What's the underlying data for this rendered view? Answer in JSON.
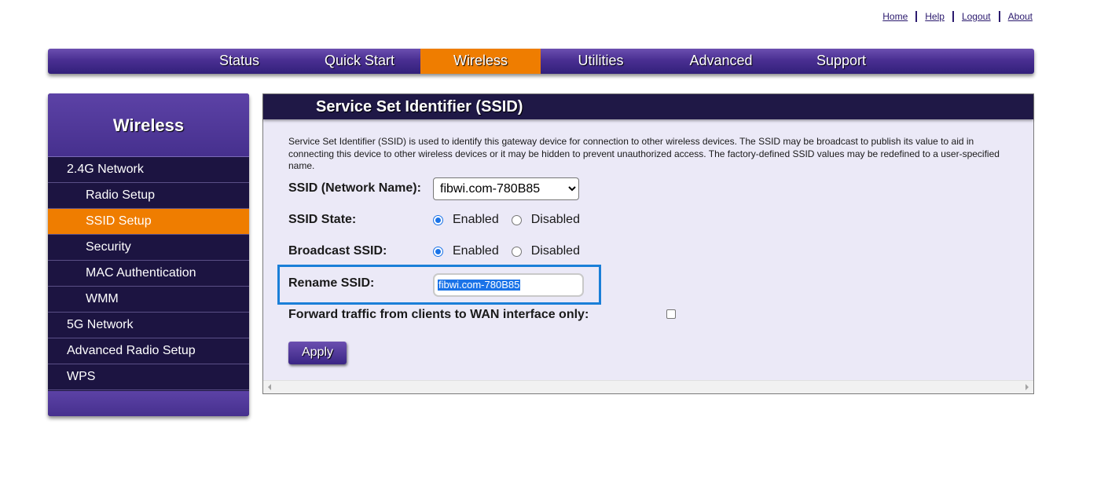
{
  "toplinks": [
    {
      "label": "Home"
    },
    {
      "label": "Help"
    },
    {
      "label": "Logout"
    },
    {
      "label": "About"
    }
  ],
  "nav": {
    "tabs": [
      {
        "label": "Status"
      },
      {
        "label": "Quick Start"
      },
      {
        "label": "Wireless"
      },
      {
        "label": "Utilities"
      },
      {
        "label": "Advanced"
      },
      {
        "label": "Support"
      }
    ],
    "active": "Wireless"
  },
  "sidebar": {
    "title": "Wireless",
    "items": [
      {
        "label": "2.4G Network"
      },
      {
        "label": "Radio Setup"
      },
      {
        "label": "SSID Setup"
      },
      {
        "label": "Security"
      },
      {
        "label": "MAC Authentication"
      },
      {
        "label": "WMM"
      },
      {
        "label": "5G Network"
      },
      {
        "label": "Advanced Radio Setup"
      },
      {
        "label": "WPS"
      }
    ],
    "active": "SSID Setup"
  },
  "panel": {
    "title": "Service Set Identifier (SSID)",
    "description": "Service Set Identifier (SSID) is used to identify this gateway device for connection to other wireless devices. The SSID may be broadcast to publish its value to aid in connecting this device to other wireless devices or it may be hidden to prevent unauthorized access. The factory-defined SSID values may be redefined to a user-specified name.",
    "ssid_label": "SSID (Network Name):",
    "ssid_selected": "fibwi.com-780B85",
    "ssid_state_label": "SSID State:",
    "ssid_state": {
      "enabled_label": "Enabled",
      "disabled_label": "Disabled",
      "value": "Enabled"
    },
    "broadcast_label": "Broadcast SSID:",
    "broadcast": {
      "enabled_label": "Enabled",
      "disabled_label": "Disabled",
      "value": "Enabled"
    },
    "rename_label": "Rename SSID:",
    "rename_value": "fibwi.com-780B85",
    "forward_label": "Forward traffic from clients to WAN interface only:",
    "forward_checked": false,
    "apply_label": "Apply"
  },
  "colors": {
    "accent_orange": "#ef7d00",
    "nav_purple": "#4a2f92",
    "sidebar_dark": "#1c1441",
    "panel_bg": "#ebe9f7",
    "focus_blue": "#1a7fd8"
  }
}
